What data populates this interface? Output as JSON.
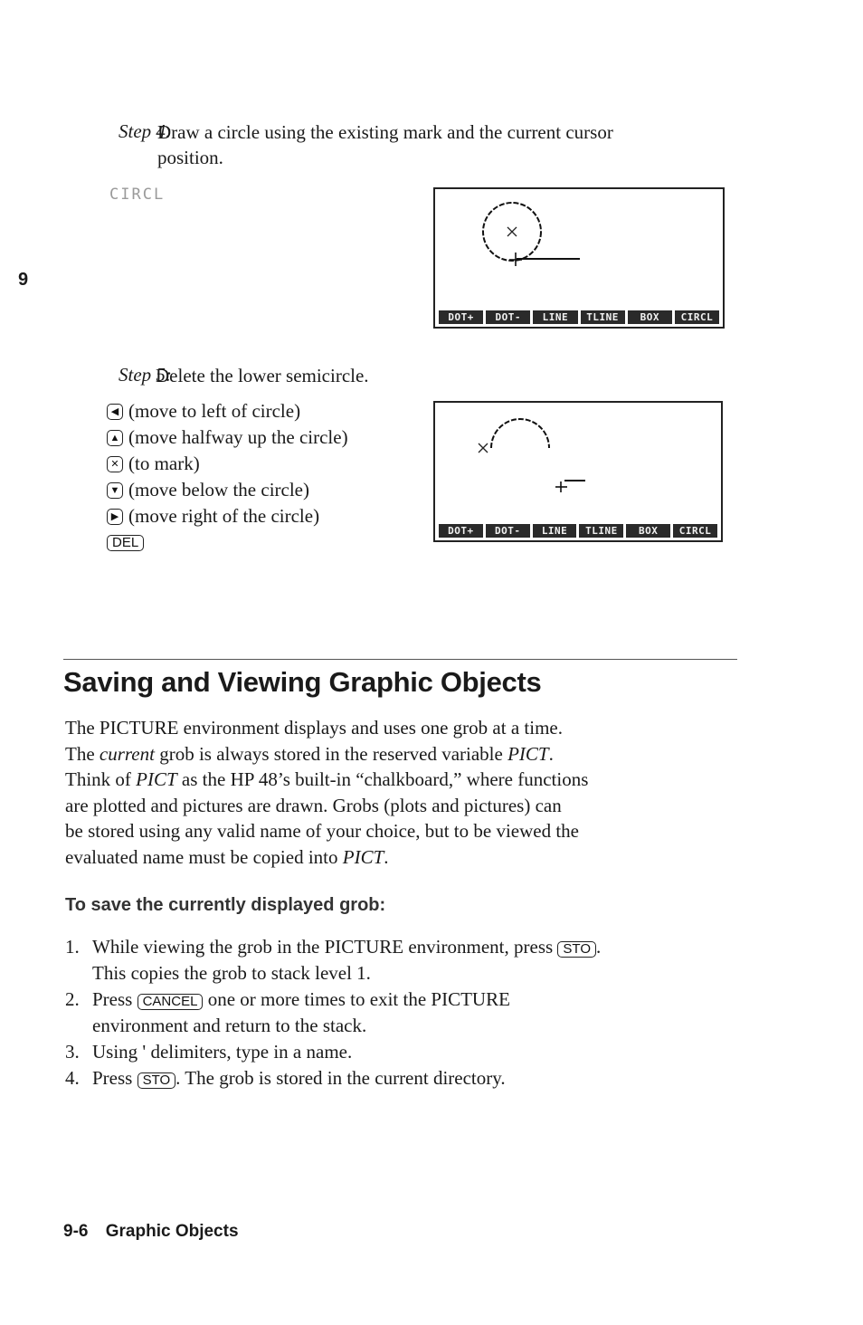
{
  "side_tab": "9",
  "step4": {
    "label": "Step 4:",
    "text_line1": "Draw a circle using the existing mark and the current cursor",
    "text_line2": "position.",
    "command": "CIRCL"
  },
  "step5": {
    "label": "Step 5:",
    "text": "Delete the lower semicircle.",
    "keys": [
      {
        "icon": "left-arrow-key-icon",
        "glyph": "◀",
        "desc": "(move to left of circle)"
      },
      {
        "icon": "up-arrow-key-icon",
        "glyph": "▲",
        "desc": "(move halfway up the circle)"
      },
      {
        "icon": "x-key-icon",
        "glyph": "✕",
        "desc": "(to mark)"
      },
      {
        "icon": "down-arrow-key-icon",
        "glyph": "▼",
        "desc": "(move below the circle)"
      },
      {
        "icon": "right-arrow-key-icon",
        "glyph": "▶",
        "desc": "(move right of the circle)"
      },
      {
        "icon": "del-key",
        "glyph": "DEL",
        "desc": ""
      }
    ]
  },
  "screen_menu": [
    "DOT+",
    "DOT-",
    "LINE",
    "TLINE",
    "BOX",
    "CIRCL"
  ],
  "section": {
    "title": "Saving and Viewing Graphic Objects",
    "para": {
      "s1": "The PICTURE environment displays and uses one grob at a time.",
      "s2a": "The ",
      "s2_it": "current",
      "s2b": " grob is always stored in the reserved variable ",
      "s2_pict": "PICT",
      "s2c": ".",
      "s3a": "Think of ",
      "s3_pict": "PICT",
      "s3b": " as the HP 48’s built-in “chalkboard,” where functions",
      "s4": "are plotted and pictures are drawn. Grobs (plots and pictures) can",
      "s5": "be stored using any valid name of your choice, but to be viewed the",
      "s6a": "evaluated name must be copied into ",
      "s6_pict": "PICT",
      "s6b": "."
    },
    "subheading": "To save the currently displayed grob:",
    "steps": [
      {
        "num": "1.",
        "a": "While viewing the grob in the PICTURE environment, press ",
        "key": "STO",
        "b": ".",
        "line2": "This copies the grob to stack level 1."
      },
      {
        "num": "2.",
        "a": "Press ",
        "key": "CANCEL",
        "b": " one or more times to exit the PICTURE",
        "line2": "environment and return to the stack."
      },
      {
        "num": "3.",
        "a": "Using ' delimiters, type in a name.",
        "key": "",
        "b": "",
        "line2": ""
      },
      {
        "num": "4.",
        "a": "Press ",
        "key": "STO",
        "b": ". The grob is stored in the current directory.",
        "line2": ""
      }
    ]
  },
  "footer": {
    "page": "9-6",
    "chapter": "Graphic Objects"
  }
}
